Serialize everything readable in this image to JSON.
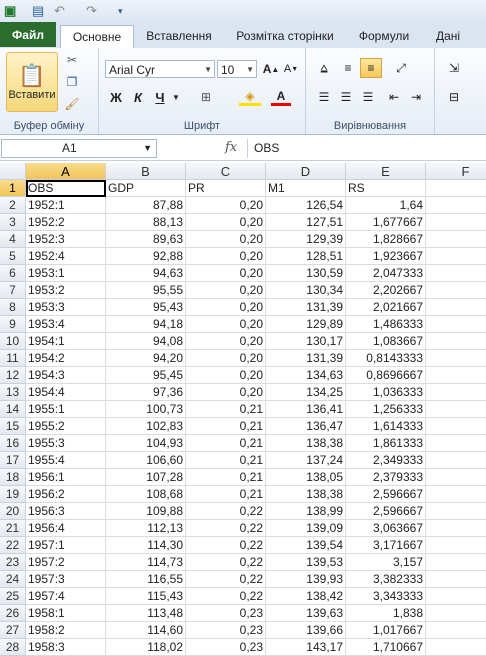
{
  "tabs": [
    "Файл",
    "Основне",
    "Вставлення",
    "Розмітка сторінки",
    "Формули",
    "Дані"
  ],
  "ribbon": {
    "paste_label": "Вставити",
    "clipboard_group": "Буфер обміну",
    "font_group": "Шрифт",
    "align_group": "Вирівнювання",
    "font_name": "Arial Cyr",
    "font_size": "10",
    "bold": "Ж",
    "italic": "К",
    "underline": "Ч"
  },
  "formula_bar": {
    "name_box": "A1",
    "fx": "fx",
    "content": "OBS"
  },
  "columns": [
    "A",
    "B",
    "C",
    "D",
    "E",
    "F"
  ],
  "header_row": [
    "OBS",
    "GDP",
    "PR",
    "M1",
    "RS"
  ],
  "rows": [
    [
      "1952:1",
      "87,88",
      "0,20",
      "126,54",
      "1,64"
    ],
    [
      "1952:2",
      "88,13",
      "0,20",
      "127,51",
      "1,677667"
    ],
    [
      "1952:3",
      "89,63",
      "0,20",
      "129,39",
      "1,828667"
    ],
    [
      "1952:4",
      "92,88",
      "0,20",
      "128,51",
      "1,923667"
    ],
    [
      "1953:1",
      "94,63",
      "0,20",
      "130,59",
      "2,047333"
    ],
    [
      "1953:2",
      "95,55",
      "0,20",
      "130,34",
      "2,202667"
    ],
    [
      "1953:3",
      "95,43",
      "0,20",
      "131,39",
      "2,021667"
    ],
    [
      "1953:4",
      "94,18",
      "0,20",
      "129,89",
      "1,486333"
    ],
    [
      "1954:1",
      "94,08",
      "0,20",
      "130,17",
      "1,083667"
    ],
    [
      "1954:2",
      "94,20",
      "0,20",
      "131,39",
      "0,8143333"
    ],
    [
      "1954:3",
      "95,45",
      "0,20",
      "134,63",
      "0,8696667"
    ],
    [
      "1954:4",
      "97,36",
      "0,20",
      "134,25",
      "1,036333"
    ],
    [
      "1955:1",
      "100,73",
      "0,21",
      "136,41",
      "1,256333"
    ],
    [
      "1955:2",
      "102,83",
      "0,21",
      "136,47",
      "1,614333"
    ],
    [
      "1955:3",
      "104,93",
      "0,21",
      "138,38",
      "1,861333"
    ],
    [
      "1955:4",
      "106,60",
      "0,21",
      "137,24",
      "2,349333"
    ],
    [
      "1956:1",
      "107,28",
      "0,21",
      "138,05",
      "2,379333"
    ],
    [
      "1956:2",
      "108,68",
      "0,21",
      "138,38",
      "2,596667"
    ],
    [
      "1956:3",
      "109,88",
      "0,22",
      "138,99",
      "2,596667"
    ],
    [
      "1956:4",
      "112,13",
      "0,22",
      "139,09",
      "3,063667"
    ],
    [
      "1957:1",
      "114,30",
      "0,22",
      "139,54",
      "3,171667"
    ],
    [
      "1957:2",
      "114,73",
      "0,22",
      "139,53",
      "3,157"
    ],
    [
      "1957:3",
      "116,55",
      "0,22",
      "139,93",
      "3,382333"
    ],
    [
      "1957:4",
      "115,43",
      "0,22",
      "138,42",
      "3,343333"
    ],
    [
      "1958:1",
      "113,48",
      "0,23",
      "139,63",
      "1,838"
    ],
    [
      "1958:2",
      "114,60",
      "0,23",
      "139,66",
      "1,017667"
    ],
    [
      "1958:3",
      "118,02",
      "0,23",
      "143,17",
      "1,710667"
    ]
  ]
}
